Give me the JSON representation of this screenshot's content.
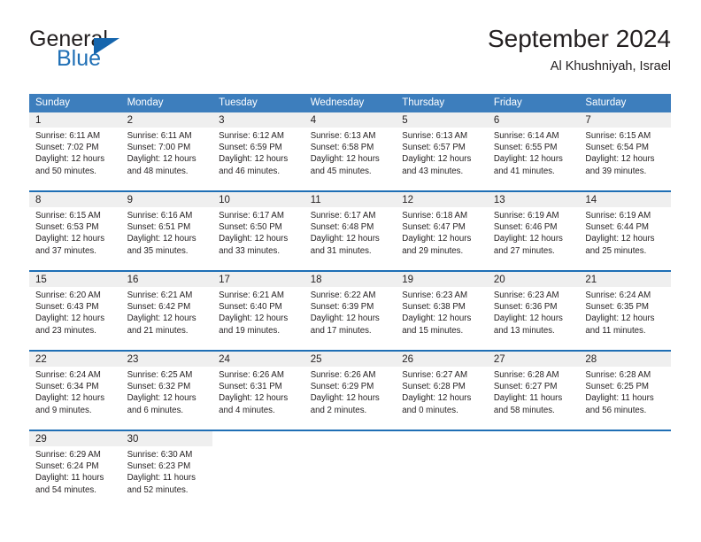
{
  "brand": {
    "name_part1": "General",
    "name_part2": "Blue",
    "flag_icon": "triangle-flag-icon"
  },
  "header": {
    "title": "September 2024",
    "location": "Al Khushniyah, Israel"
  },
  "colors": {
    "header_blue": "#3d7ebd",
    "rule_blue": "#1f6fb5",
    "daynum_band": "#efefef",
    "text": "#231f20"
  },
  "calendar": {
    "weekday_headers": [
      "Sunday",
      "Monday",
      "Tuesday",
      "Wednesday",
      "Thursday",
      "Friday",
      "Saturday"
    ],
    "weeks": [
      [
        {
          "day": "1",
          "sunrise": "Sunrise: 6:11 AM",
          "sunset": "Sunset: 7:02 PM",
          "daylight1": "Daylight: 12 hours",
          "daylight2": "and 50 minutes."
        },
        {
          "day": "2",
          "sunrise": "Sunrise: 6:11 AM",
          "sunset": "Sunset: 7:00 PM",
          "daylight1": "Daylight: 12 hours",
          "daylight2": "and 48 minutes."
        },
        {
          "day": "3",
          "sunrise": "Sunrise: 6:12 AM",
          "sunset": "Sunset: 6:59 PM",
          "daylight1": "Daylight: 12 hours",
          "daylight2": "and 46 minutes."
        },
        {
          "day": "4",
          "sunrise": "Sunrise: 6:13 AM",
          "sunset": "Sunset: 6:58 PM",
          "daylight1": "Daylight: 12 hours",
          "daylight2": "and 45 minutes."
        },
        {
          "day": "5",
          "sunrise": "Sunrise: 6:13 AM",
          "sunset": "Sunset: 6:57 PM",
          "daylight1": "Daylight: 12 hours",
          "daylight2": "and 43 minutes."
        },
        {
          "day": "6",
          "sunrise": "Sunrise: 6:14 AM",
          "sunset": "Sunset: 6:55 PM",
          "daylight1": "Daylight: 12 hours",
          "daylight2": "and 41 minutes."
        },
        {
          "day": "7",
          "sunrise": "Sunrise: 6:15 AM",
          "sunset": "Sunset: 6:54 PM",
          "daylight1": "Daylight: 12 hours",
          "daylight2": "and 39 minutes."
        }
      ],
      [
        {
          "day": "8",
          "sunrise": "Sunrise: 6:15 AM",
          "sunset": "Sunset: 6:53 PM",
          "daylight1": "Daylight: 12 hours",
          "daylight2": "and 37 minutes."
        },
        {
          "day": "9",
          "sunrise": "Sunrise: 6:16 AM",
          "sunset": "Sunset: 6:51 PM",
          "daylight1": "Daylight: 12 hours",
          "daylight2": "and 35 minutes."
        },
        {
          "day": "10",
          "sunrise": "Sunrise: 6:17 AM",
          "sunset": "Sunset: 6:50 PM",
          "daylight1": "Daylight: 12 hours",
          "daylight2": "and 33 minutes."
        },
        {
          "day": "11",
          "sunrise": "Sunrise: 6:17 AM",
          "sunset": "Sunset: 6:48 PM",
          "daylight1": "Daylight: 12 hours",
          "daylight2": "and 31 minutes."
        },
        {
          "day": "12",
          "sunrise": "Sunrise: 6:18 AM",
          "sunset": "Sunset: 6:47 PM",
          "daylight1": "Daylight: 12 hours",
          "daylight2": "and 29 minutes."
        },
        {
          "day": "13",
          "sunrise": "Sunrise: 6:19 AM",
          "sunset": "Sunset: 6:46 PM",
          "daylight1": "Daylight: 12 hours",
          "daylight2": "and 27 minutes."
        },
        {
          "day": "14",
          "sunrise": "Sunrise: 6:19 AM",
          "sunset": "Sunset: 6:44 PM",
          "daylight1": "Daylight: 12 hours",
          "daylight2": "and 25 minutes."
        }
      ],
      [
        {
          "day": "15",
          "sunrise": "Sunrise: 6:20 AM",
          "sunset": "Sunset: 6:43 PM",
          "daylight1": "Daylight: 12 hours",
          "daylight2": "and 23 minutes."
        },
        {
          "day": "16",
          "sunrise": "Sunrise: 6:21 AM",
          "sunset": "Sunset: 6:42 PM",
          "daylight1": "Daylight: 12 hours",
          "daylight2": "and 21 minutes."
        },
        {
          "day": "17",
          "sunrise": "Sunrise: 6:21 AM",
          "sunset": "Sunset: 6:40 PM",
          "daylight1": "Daylight: 12 hours",
          "daylight2": "and 19 minutes."
        },
        {
          "day": "18",
          "sunrise": "Sunrise: 6:22 AM",
          "sunset": "Sunset: 6:39 PM",
          "daylight1": "Daylight: 12 hours",
          "daylight2": "and 17 minutes."
        },
        {
          "day": "19",
          "sunrise": "Sunrise: 6:23 AM",
          "sunset": "Sunset: 6:38 PM",
          "daylight1": "Daylight: 12 hours",
          "daylight2": "and 15 minutes."
        },
        {
          "day": "20",
          "sunrise": "Sunrise: 6:23 AM",
          "sunset": "Sunset: 6:36 PM",
          "daylight1": "Daylight: 12 hours",
          "daylight2": "and 13 minutes."
        },
        {
          "day": "21",
          "sunrise": "Sunrise: 6:24 AM",
          "sunset": "Sunset: 6:35 PM",
          "daylight1": "Daylight: 12 hours",
          "daylight2": "and 11 minutes."
        }
      ],
      [
        {
          "day": "22",
          "sunrise": "Sunrise: 6:24 AM",
          "sunset": "Sunset: 6:34 PM",
          "daylight1": "Daylight: 12 hours",
          "daylight2": "and 9 minutes."
        },
        {
          "day": "23",
          "sunrise": "Sunrise: 6:25 AM",
          "sunset": "Sunset: 6:32 PM",
          "daylight1": "Daylight: 12 hours",
          "daylight2": "and 6 minutes."
        },
        {
          "day": "24",
          "sunrise": "Sunrise: 6:26 AM",
          "sunset": "Sunset: 6:31 PM",
          "daylight1": "Daylight: 12 hours",
          "daylight2": "and 4 minutes."
        },
        {
          "day": "25",
          "sunrise": "Sunrise: 6:26 AM",
          "sunset": "Sunset: 6:29 PM",
          "daylight1": "Daylight: 12 hours",
          "daylight2": "and 2 minutes."
        },
        {
          "day": "26",
          "sunrise": "Sunrise: 6:27 AM",
          "sunset": "Sunset: 6:28 PM",
          "daylight1": "Daylight: 12 hours",
          "daylight2": "and 0 minutes."
        },
        {
          "day": "27",
          "sunrise": "Sunrise: 6:28 AM",
          "sunset": "Sunset: 6:27 PM",
          "daylight1": "Daylight: 11 hours",
          "daylight2": "and 58 minutes."
        },
        {
          "day": "28",
          "sunrise": "Sunrise: 6:28 AM",
          "sunset": "Sunset: 6:25 PM",
          "daylight1": "Daylight: 11 hours",
          "daylight2": "and 56 minutes."
        }
      ],
      [
        {
          "day": "29",
          "sunrise": "Sunrise: 6:29 AM",
          "sunset": "Sunset: 6:24 PM",
          "daylight1": "Daylight: 11 hours",
          "daylight2": "and 54 minutes."
        },
        {
          "day": "30",
          "sunrise": "Sunrise: 6:30 AM",
          "sunset": "Sunset: 6:23 PM",
          "daylight1": "Daylight: 11 hours",
          "daylight2": "and 52 minutes."
        },
        {
          "day": "",
          "sunrise": "",
          "sunset": "",
          "daylight1": "",
          "daylight2": ""
        },
        {
          "day": "",
          "sunrise": "",
          "sunset": "",
          "daylight1": "",
          "daylight2": ""
        },
        {
          "day": "",
          "sunrise": "",
          "sunset": "",
          "daylight1": "",
          "daylight2": ""
        },
        {
          "day": "",
          "sunrise": "",
          "sunset": "",
          "daylight1": "",
          "daylight2": ""
        },
        {
          "day": "",
          "sunrise": "",
          "sunset": "",
          "daylight1": "",
          "daylight2": ""
        }
      ]
    ]
  }
}
